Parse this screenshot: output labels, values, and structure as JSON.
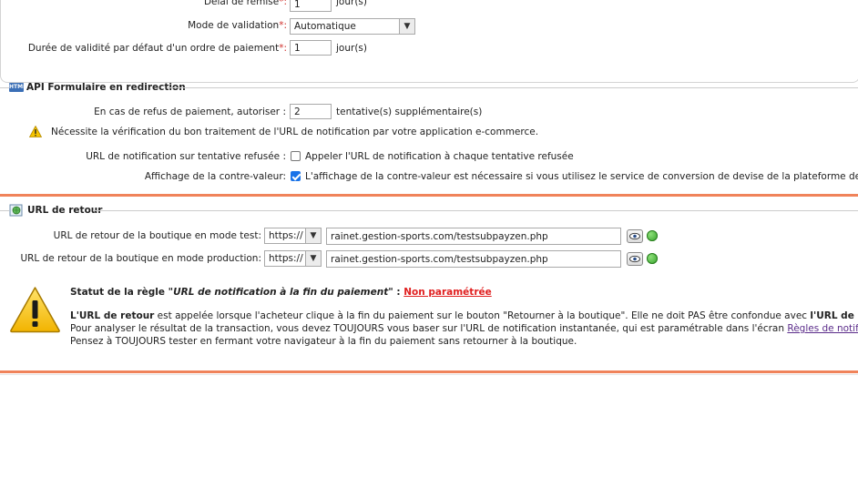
{
  "top_form": {
    "delay": {
      "label": "Délai de remise",
      "required": "*:",
      "value": "1",
      "unit": "jour(s)"
    },
    "validation_mode": {
      "label": "Mode de validation",
      "required": "*:",
      "value": "Automatique"
    },
    "validity": {
      "label": "Durée de validité par défaut d'un ordre de paiement",
      "required": "*:",
      "value": "1",
      "unit": "jour(s)"
    }
  },
  "api_section": {
    "title": "API Formulaire en redirection",
    "icon_text": "HTML",
    "refusal": {
      "label": "En cas de refus de paiement, autoriser :",
      "value": "2",
      "unit": "tentative(s) supplémentaire(s)"
    },
    "warning": "Nécessite la vérification du bon traitement de l'URL de notification par votre application e-commerce.",
    "notif_url": {
      "label": "URL de notification sur tentative refusée :",
      "checkbox_label": "Appeler l'URL de notification à chaque tentative refusée",
      "checked": false
    },
    "countervalue": {
      "label": "Affichage de la contre-valeur:",
      "checkbox_label": "L'affichage de la contre-valeur est nécessaire si vous utilisez le service de conversion de devise de la plateforme de paiement.",
      "checked": true
    }
  },
  "return_section": {
    "title": "URL de retour",
    "test": {
      "label": "URL de retour de la boutique en mode test:",
      "protocol": "https://",
      "url": "rainet.gestion-sports.com/testsubpayzen.php"
    },
    "production": {
      "label": "URL de retour de la boutique en mode production:",
      "protocol": "https://",
      "url": "rainet.gestion-sports.com/testsubpayzen.php"
    },
    "status": {
      "prefix": "Statut de la règle \"",
      "rule": "URL de notification à la fin du paiement",
      "suffix": "\" :",
      "value": "Non paramétrée"
    },
    "info": {
      "line1_bold": "L'URL de retour",
      "line1_text": " est appelée lorsque l'acheteur clique à la fin du paiement sur le bouton \"Retourner à la boutique\". Elle ne doit PAS être confondue avec ",
      "line1_bold2": "l'URL de notification",
      "line2_text": "Pour analyser le résultat de la transaction, vous devez TOUJOURS vous baser sur l'URL de notification instantanée, qui est paramétrable dans l'écran ",
      "line2_link": "Règles de notifications",
      "line3_text": "Pensez à TOUJOURS tester en fermant votre navigateur à la fin du paiement sans retourner à la boutique."
    }
  },
  "colors": {
    "accent_orange": "#f0835a",
    "required_red": "#d0312d",
    "link_purple": "#5b2c8a",
    "status_red": "#e02020"
  }
}
